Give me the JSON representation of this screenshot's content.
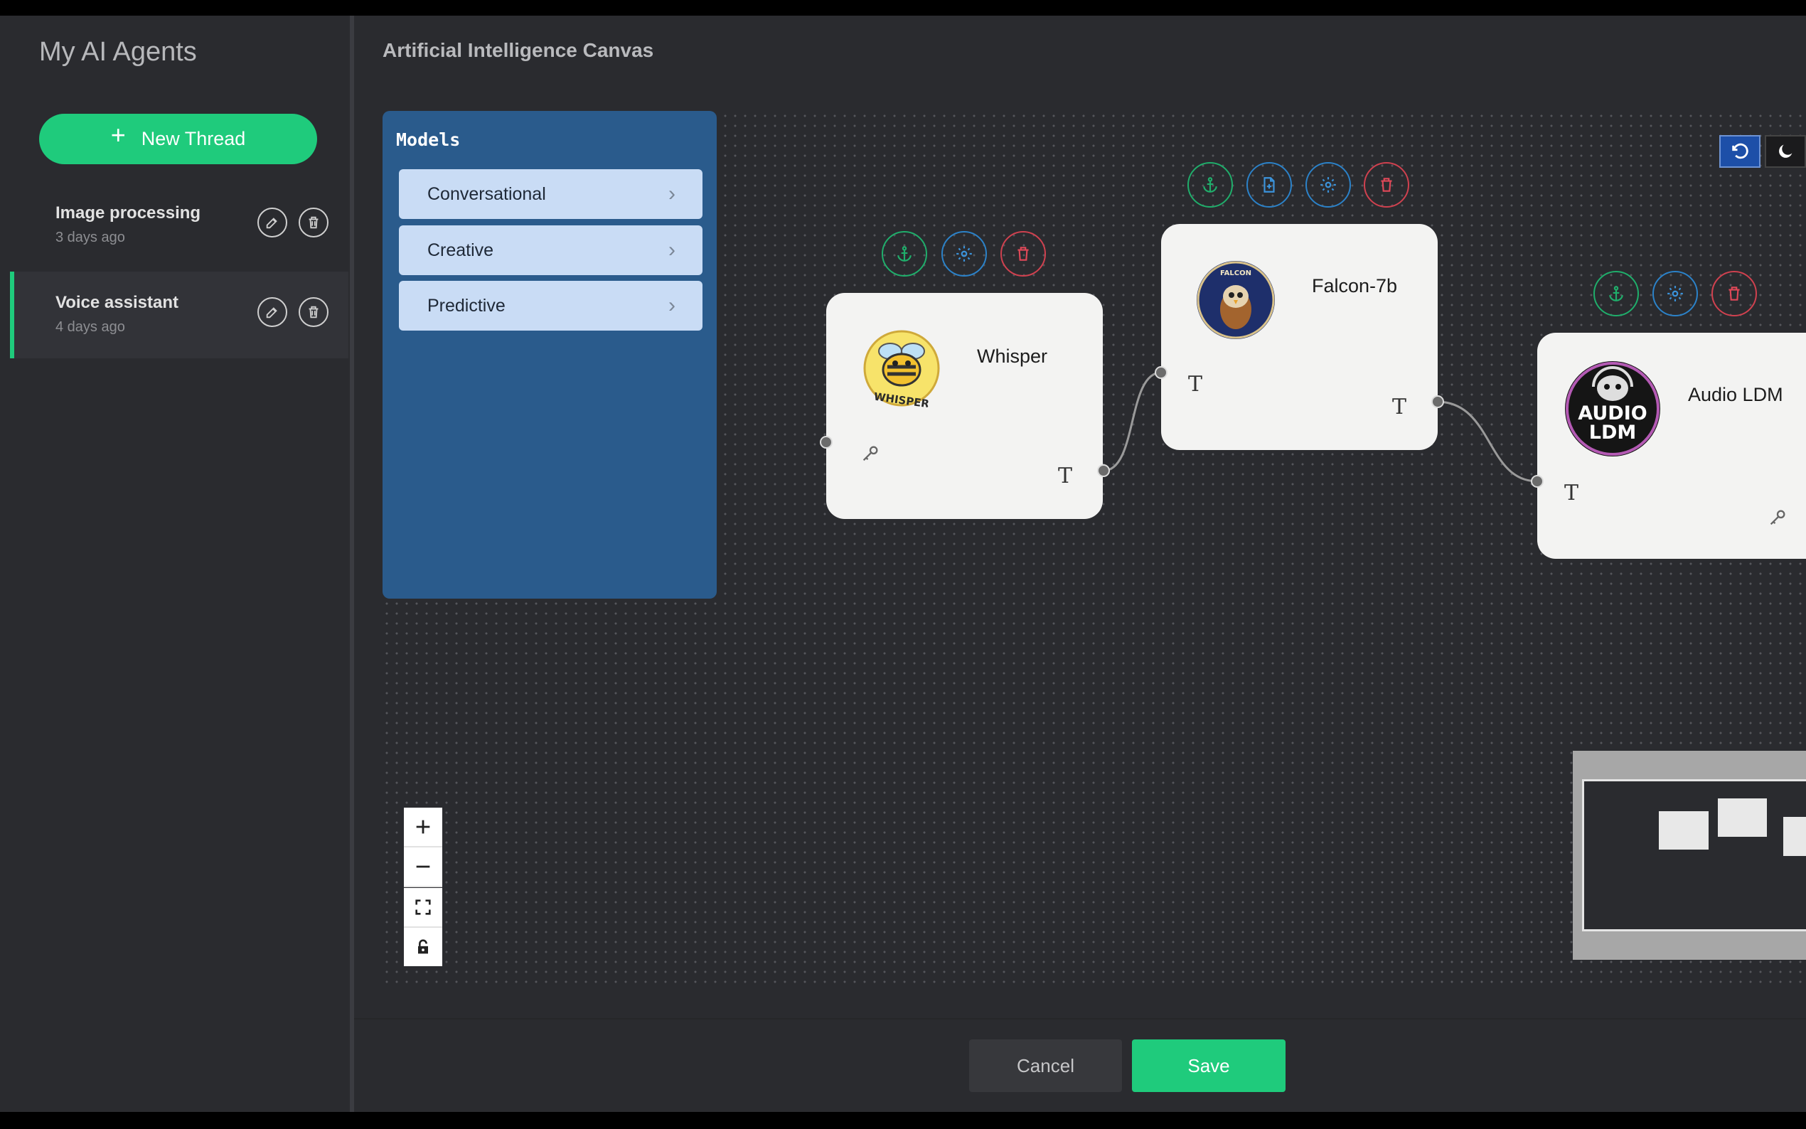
{
  "sidebar": {
    "title": "My AI Agents",
    "new_thread_label": "New Thread",
    "threads": [
      {
        "title": "Image processing",
        "time": "3 days ago"
      },
      {
        "title": "Voice assistant",
        "time": "4 days ago"
      }
    ]
  },
  "canvas": {
    "title": "Artificial Intelligence Canvas",
    "models_panel": {
      "title": "Models",
      "categories": [
        "Conversational",
        "Creative",
        "Predictive"
      ]
    },
    "nodes": [
      {
        "name": "Whisper",
        "logo": "whisper-bee-logo",
        "logo_text": "WHISPER",
        "io_glyph": "T"
      },
      {
        "name": "Falcon-7b",
        "logo": "falcon-bird-logo",
        "logo_text": "FALCON",
        "io_glyph": "T"
      },
      {
        "name": "Audio LDM",
        "logo": "audio-ldm-monkey-logo",
        "logo_text_1": "AUDIO",
        "logo_text_2": "LDM",
        "io_glyph": "T"
      }
    ]
  },
  "footer": {
    "cancel_label": "Cancel",
    "save_label": "Save"
  },
  "colors": {
    "accent_green": "#1fcb7c",
    "models_panel": "#2a5b8c",
    "category_bg": "#c9dcf5",
    "tool_green": "#1fae6b",
    "tool_blue": "#2b82c9",
    "tool_red": "#d0414f"
  }
}
